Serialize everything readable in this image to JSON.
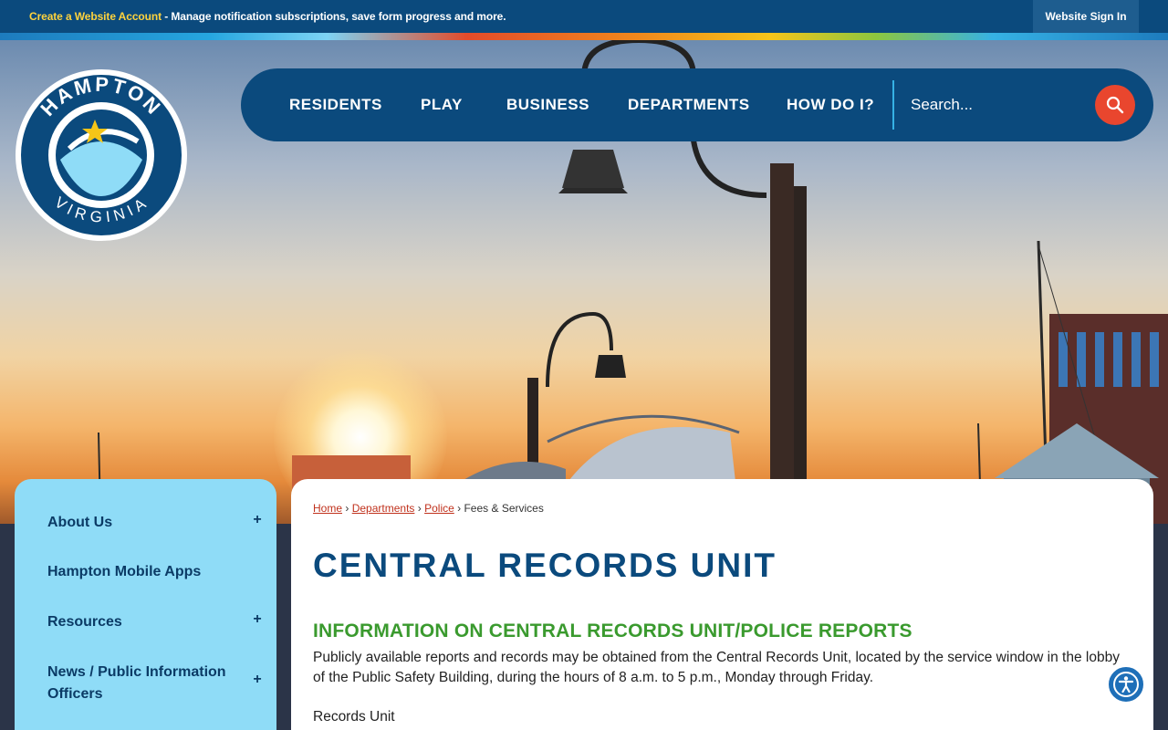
{
  "topbar": {
    "create_account_link": "Create a Website Account",
    "notice_text": " - Manage notification subscriptions, save form progress and more.",
    "sign_in": "Website Sign In"
  },
  "logo": {
    "top_text": "HAMPTON",
    "bottom_text": "VIRGINIA"
  },
  "nav": {
    "items": [
      "RESIDENTS",
      "PLAY",
      "BUSINESS",
      "DEPARTMENTS",
      "HOW DO I?"
    ],
    "search_placeholder": "Search..."
  },
  "sidebar": {
    "items": [
      {
        "label": "About Us",
        "toggle": "+"
      },
      {
        "label": "Hampton Mobile Apps",
        "toggle": ""
      },
      {
        "label": "Resources",
        "toggle": "+"
      },
      {
        "label": "News / Public Information Officers",
        "toggle": "+"
      }
    ]
  },
  "breadcrumb": {
    "items": [
      "Home",
      "Departments",
      "Police"
    ],
    "separator": "›",
    "current": "Fees & Services"
  },
  "content": {
    "title": "CENTRAL RECORDS UNIT",
    "section_heading": "INFORMATION ON CENTRAL RECORDS UNIT/POLICE REPORTS",
    "paragraph": "Publicly available reports and records may be obtained from the Central Records Unit, located by the service window in the lobby of the Public Safety Building, during the hours of 8 a.m. to 5 p.m., Monday through Friday.",
    "records_label": "Records Unit"
  },
  "colors": {
    "navy": "#0b4a7d",
    "accent_red": "#e9462e",
    "sidebar_bg": "#8fdcf7",
    "heading_green": "#3a9a2e",
    "link_red": "#c0311c"
  }
}
